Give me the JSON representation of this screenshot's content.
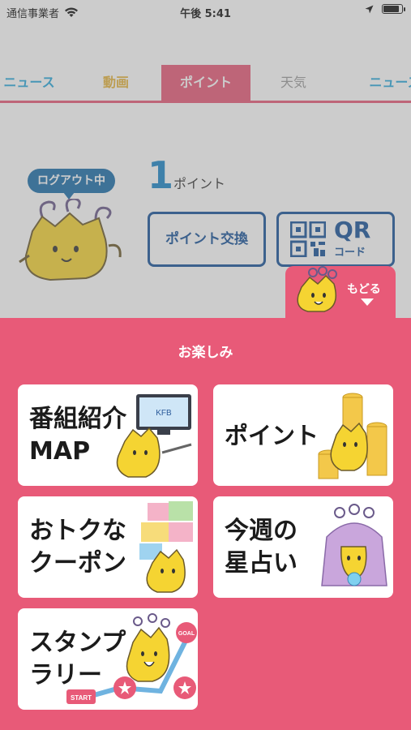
{
  "status_bar": {
    "carrier": "通信事業者",
    "time": "午後 5:41",
    "battery_level": 0.95
  },
  "tabs": [
    {
      "label": "ニュース",
      "color": "#29a9dc"
    },
    {
      "label": "動画",
      "color": "#e5b43a"
    },
    {
      "label": "ポイント",
      "color": "#ffffff",
      "active": true
    },
    {
      "label": "天気",
      "color": "#9a9a9a"
    },
    {
      "label": "ニュース",
      "color": "#29a9dc"
    }
  ],
  "points_panel": {
    "logout_badge": "ログアウト中",
    "points_value": "1",
    "points_unit": "ポイント",
    "exchange_button": "ポイント交換",
    "qr_button_big": "QR",
    "qr_button_small": "コード"
  },
  "back_tab": {
    "label": "もどる"
  },
  "sheet": {
    "title": "お楽しみ",
    "cards": [
      {
        "line1": "番組紹介",
        "line2": "MAP",
        "icon": "tv-mascot-illustration"
      },
      {
        "line1": "ポイント",
        "line2": "",
        "icon": "coins-mascot-illustration"
      },
      {
        "line1": "おトクな",
        "line2": "クーポン",
        "icon": "gift-mascot-illustration"
      },
      {
        "line1": "今週の",
        "line2": "星占い",
        "icon": "fortune-mascot-illustration"
      },
      {
        "line1": "スタンプ",
        "line2": "ラリー",
        "icon": "stamp-rally-mascot-illustration"
      }
    ],
    "tv_screen_text": "KFB",
    "stamp_start": "START",
    "stamp_goal": "GOAL"
  },
  "colors": {
    "accent_pink": "#e85a78",
    "navy": "#17539a",
    "mascot_yellow": "#f5d432"
  }
}
